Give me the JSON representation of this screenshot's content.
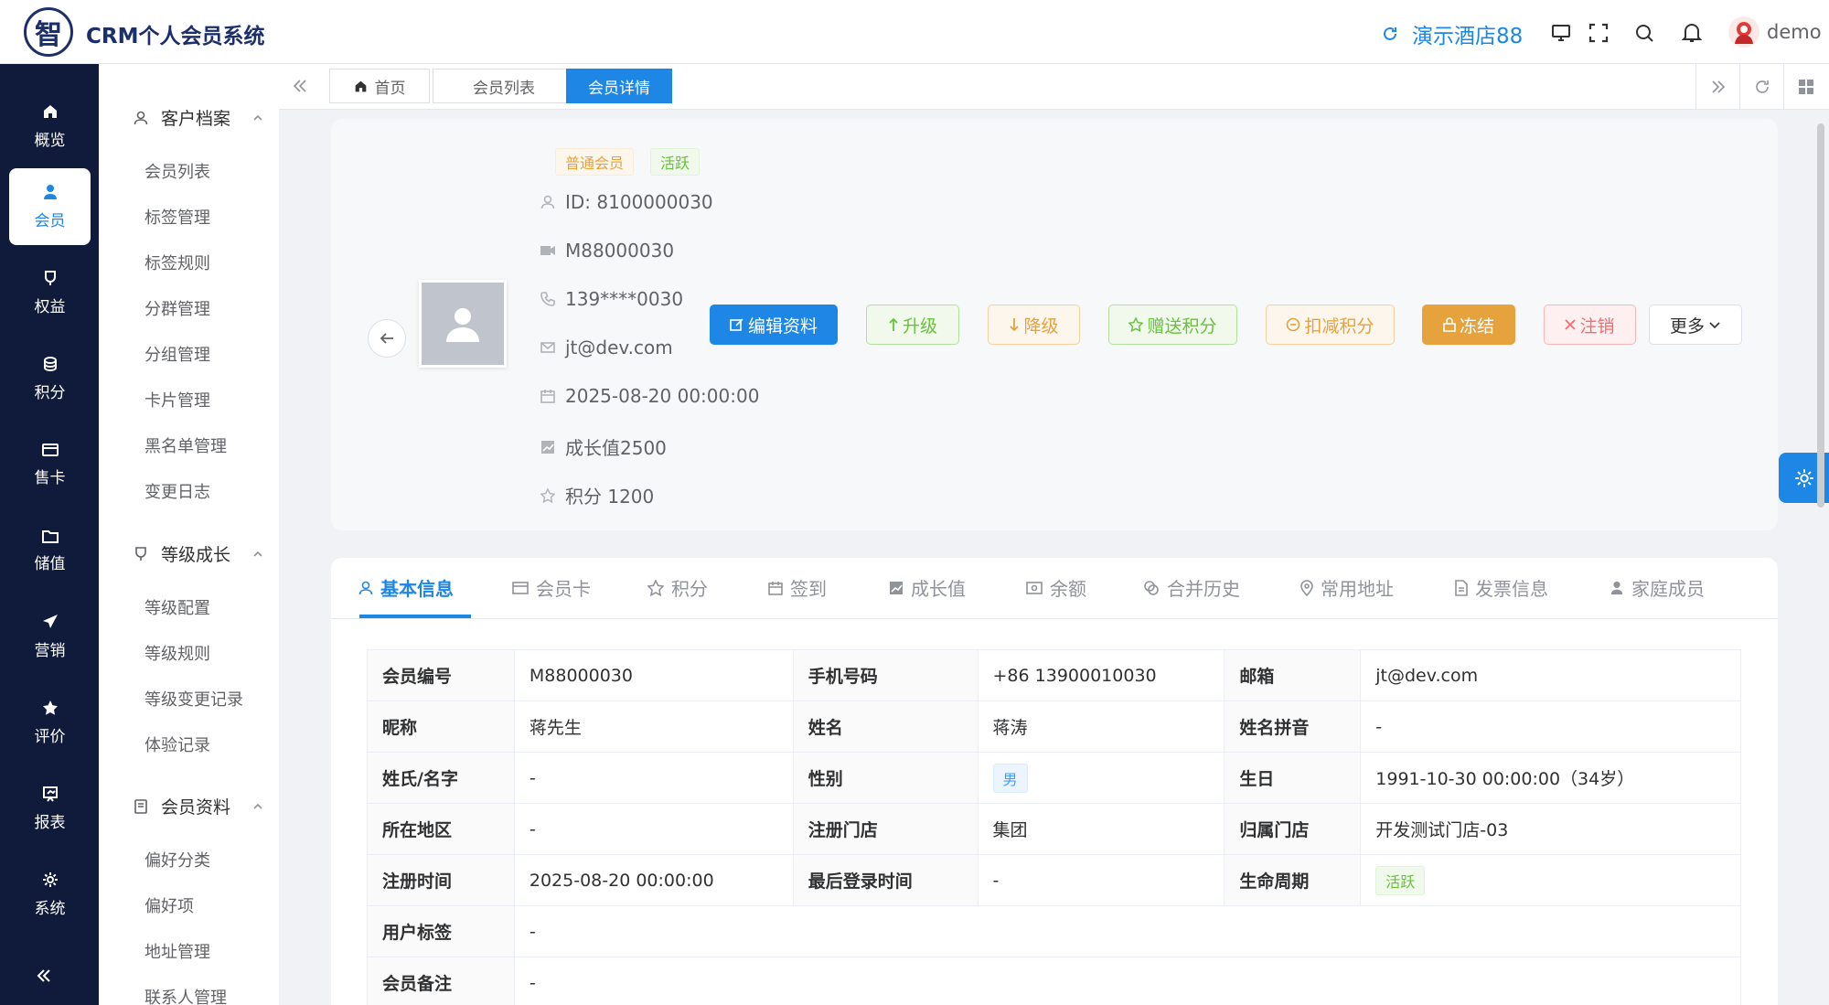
{
  "header": {
    "logo_char": "智",
    "app_title": "CRM个人会员系统",
    "hotel_name": "演示酒店88",
    "username": "demo"
  },
  "nav": {
    "items": [
      {
        "label": "概览",
        "icon": "home-icon"
      },
      {
        "label": "会员",
        "icon": "user-icon"
      },
      {
        "label": "权益",
        "icon": "cup-icon"
      },
      {
        "label": "积分",
        "icon": "coins-icon"
      },
      {
        "label": "售卡",
        "icon": "card-icon"
      },
      {
        "label": "储值",
        "icon": "wallet-icon"
      },
      {
        "label": "营销",
        "icon": "send-icon"
      },
      {
        "label": "评价",
        "icon": "star-icon"
      },
      {
        "label": "报表",
        "icon": "report-icon"
      },
      {
        "label": "系统",
        "icon": "gear-icon"
      }
    ]
  },
  "submenu": {
    "groups": [
      {
        "title": "客户档案",
        "items": [
          "会员列表",
          "标签管理",
          "标签规则",
          "分群管理",
          "分组管理",
          "卡片管理",
          "黑名单管理",
          "变更日志"
        ]
      },
      {
        "title": "等级成长",
        "items": [
          "等级配置",
          "等级规则",
          "等级变更记录",
          "体验记录"
        ]
      },
      {
        "title": "会员资料",
        "items": [
          "偏好分类",
          "偏好项",
          "地址管理",
          "联系人管理"
        ]
      }
    ]
  },
  "tabs": [
    "首页",
    "会员列表",
    "会员详情"
  ],
  "profile": {
    "level_tag": "普通会员",
    "status_tag": "活跃",
    "id": "ID: 8100000030",
    "member_no": "M88000030",
    "phone": "139****0030",
    "email": "jt@dev.com",
    "date": "2025-08-20 00:00:00",
    "growth": "成长值2500",
    "points": "积分 1200"
  },
  "actions": {
    "edit": "编辑资料",
    "upgrade": "升级",
    "downgrade": "降级",
    "gift_points": "赠送积分",
    "deduct_points": "扣减积分",
    "freeze": "冻结",
    "cancel": "注销",
    "more": "更多"
  },
  "detail_tabs": [
    "基本信息",
    "会员卡",
    "积分",
    "签到",
    "成长值",
    "余额",
    "合并历史",
    "常用地址",
    "发票信息",
    "家庭成员"
  ],
  "details": {
    "member_no_label": "会员编号",
    "member_no": "M88000030",
    "mobile_label": "手机号码",
    "mobile": "+86 13900010030",
    "email_label": "邮箱",
    "email": "jt@dev.com",
    "nickname_label": "昵称",
    "nickname": "蒋先生",
    "name_label": "姓名",
    "name": "蒋涛",
    "pinyin_label": "姓名拼音",
    "pinyin": "-",
    "surname_label": "姓氏/名字",
    "surname": "-",
    "gender_label": "性别",
    "gender": "男",
    "birthday_label": "生日",
    "birthday": "1991-10-30 00:00:00（34岁）",
    "region_label": "所在地区",
    "region": "-",
    "reg_store_label": "注册门店",
    "reg_store": "集团",
    "home_store_label": "归属门店",
    "home_store": "开发测试门店-03",
    "reg_time_label": "注册时间",
    "reg_time": "2025-08-20 00:00:00",
    "last_login_label": "最后登录时间",
    "last_login": "-",
    "lifecycle_label": "生命周期",
    "lifecycle": "活跃",
    "user_tags_label": "用户标签",
    "user_tags": "-",
    "remark_label": "会员备注",
    "remark": "-"
  },
  "colors": {
    "primary": "#1e87e6",
    "nav_bg": "#101a3b",
    "success": "#67c23a",
    "warning": "#e6a23c",
    "danger": "#f56c6c",
    "freeze": "#e6a23c"
  }
}
